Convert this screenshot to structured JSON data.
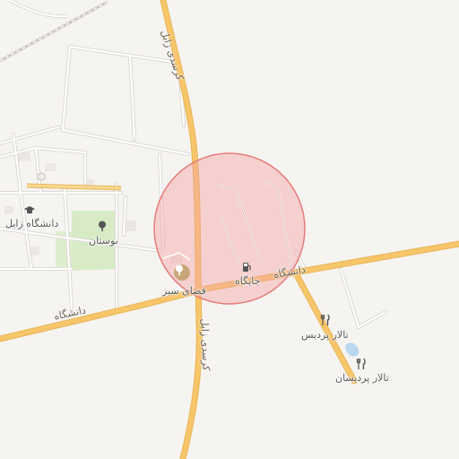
{
  "map": {
    "roads": {
      "north_south": "کرسدی زابل",
      "east_west_left": "دانشگاه",
      "east_west_right": "دانشگاه"
    },
    "places": {
      "university": "دانشگاه زابل",
      "garden": "بوستان",
      "green_space": "فضای سبز",
      "gas_station": "جایگاه",
      "hall_1": "تالار پردیس",
      "hall_2": "تالار پردیسان"
    },
    "icons": {
      "university": "graduation-cap-icon",
      "garden": "tree-icon",
      "green_space": "tree-icon",
      "gas_station": "fuel-pump-icon",
      "hall_1": "fork-knife-icon",
      "hall_2": "fork-knife-icon"
    },
    "colors": {
      "background": "#f6f4f1",
      "major_road": "#f7c66b",
      "major_road_casing": "#e8b457",
      "minor_road": "#ffffff",
      "minor_road_casing": "#d9d6d2",
      "park": "#d7ecc6",
      "highlight_circle_fill": "#f4a3a3",
      "highlight_circle_stroke": "#e57c7c",
      "railway": "#9b9b9b",
      "water": "#b9d8f0"
    }
  }
}
